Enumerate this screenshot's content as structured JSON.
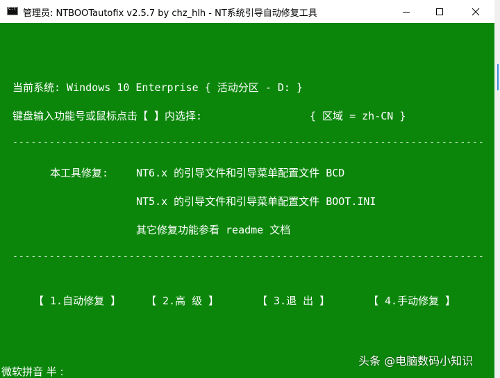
{
  "window": {
    "title": "管理员: NTBOOTautofix v2.5.7 by chz_hlh - NT系统引导自动修复工具",
    "icon": "console-icon",
    "minimize_icon": "minimize-icon",
    "maximize_icon": "maximize-icon",
    "close_icon": "close-icon"
  },
  "colors": {
    "console_bg": "#0b860b",
    "console_text": "#ffffff",
    "titlebar_bg": "#ffffff"
  },
  "console": {
    "system_line": "当前系统: Windows 10 Enterprise  { 活动分区 - D: }",
    "prompt_line": "键盘输入功能号或鼠标点击【 】内选择:",
    "region_line": "{ 区域 = zh-CN }",
    "separator": "--------------------------------------------------------------------------------------------------------------",
    "repair_label": "本工具修复:",
    "repair_item_1": "NT6.x 的引导文件和引导菜单配置文件 BCD",
    "repair_item_2": "NT5.x 的引导文件和引导菜单配置文件 BOOT.INI",
    "repair_item_3": "其它修复功能参看 readme 文档",
    "menu": [
      {
        "label": "【 1.自动修复 】"
      },
      {
        "label": "【  2.高  级  】"
      },
      {
        "label": "【  3.退  出  】"
      },
      {
        "label": "【 4.手动修复 】"
      }
    ],
    "ime_status": "微软拼音 半 :"
  },
  "watermark": "头条 @电脑数码小知识"
}
